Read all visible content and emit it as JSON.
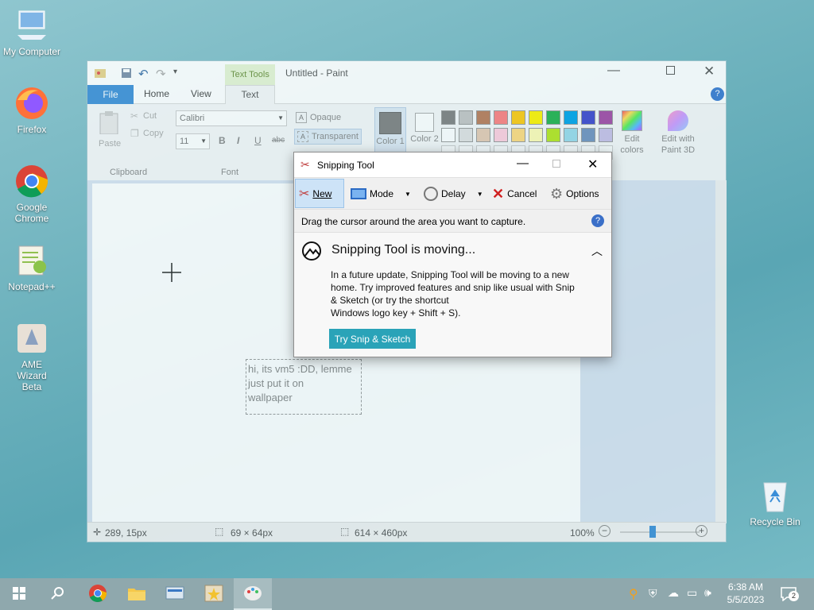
{
  "desktop": {
    "icons": [
      {
        "label": "My Computer"
      },
      {
        "label": "Firefox"
      },
      {
        "label": "Google Chrome"
      },
      {
        "label": "Notepad++"
      },
      {
        "label": "AME Wizard Beta"
      },
      {
        "label": "Recycle Bin"
      }
    ]
  },
  "paint": {
    "title": "Untitled - Paint",
    "context_tab": "Text Tools",
    "tabs": [
      "File",
      "Home",
      "View",
      "Text"
    ],
    "clipboard": {
      "paste": "Paste",
      "cut": "Cut",
      "copy": "Copy",
      "group": "Clipboard"
    },
    "font": {
      "name": "Calibri",
      "size": "11",
      "group": "Font"
    },
    "background": {
      "opaque": "Opaque",
      "transparent": "Transparent"
    },
    "color1": "Color 1",
    "color2": "Color 2",
    "edit_colors": "Edit colors",
    "edit_paint3d": "Edit with Paint 3D",
    "canvas_text": [
      "hi, its vm5 :DD, lemme",
      "just put it on",
      "wallpaper"
    ],
    "status": {
      "cursor": "289, 15px",
      "selection": "69 × 64px",
      "image_size": "614 × 460px",
      "zoom": "100%"
    },
    "palette_row1": [
      "#7f7f7f",
      "#c3c3c3",
      "#b97a57",
      "#ff7f7f",
      "#ffc90e",
      "#fff200",
      "#22b14c",
      "#00a2e8",
      "#3f48cc",
      "#a349a4"
    ],
    "palette_row2": [
      "#ffffff",
      "#e0e0e0",
      "#e5c9b2",
      "#ffcddd",
      "#ffd97d",
      "#fffbb5",
      "#b5e61d",
      "#99d9ea",
      "#7092be",
      "#c8bfe7"
    ]
  },
  "snip": {
    "title": "Snipping Tool",
    "toolbar": {
      "new": "New",
      "mode": "Mode",
      "delay": "Delay",
      "cancel": "Cancel",
      "options": "Options"
    },
    "hint": "Drag the cursor around the area you want to capture.",
    "heading": "Snipping Tool is moving...",
    "body_lines": [
      "In a future update, Snipping Tool will be moving to a new",
      "home. Try improved features and snip like usual with Snip",
      "& Sketch (or try the shortcut",
      "Windows logo key + Shift + S)."
    ],
    "button": "Try Snip & Sketch"
  },
  "taskbar": {
    "time": "6:38 AM",
    "date": "5/5/2023",
    "notifications": "2"
  }
}
